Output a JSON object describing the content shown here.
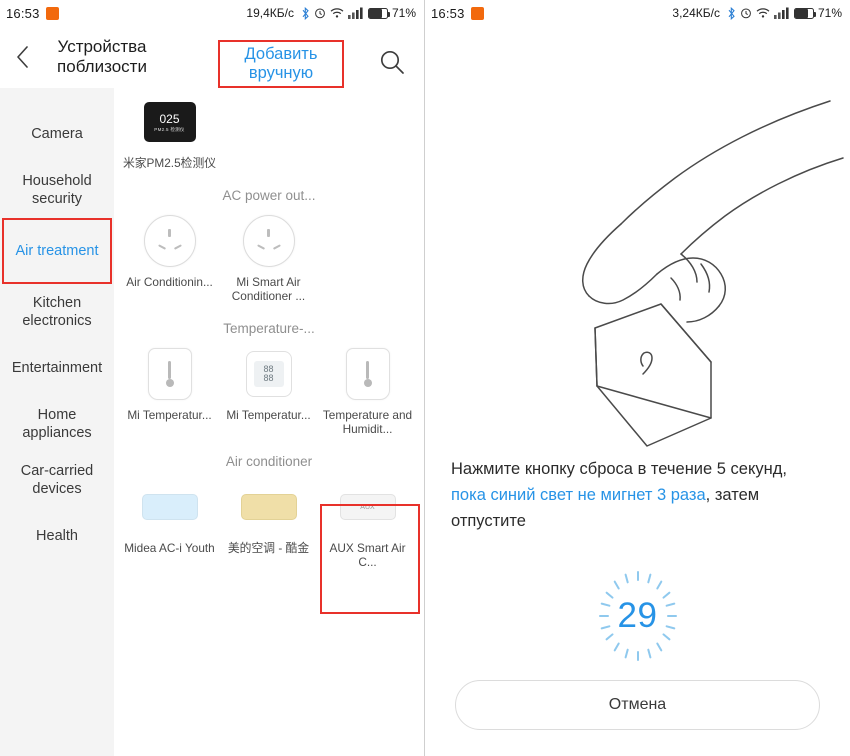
{
  "left": {
    "statusbar": {
      "time": "16:53",
      "rate": "19,4КБ/c",
      "battery_pct": "71%",
      "battery_level": 71,
      "icons": [
        "alarm-icon",
        "bluetooth-icon",
        "wifi-icon",
        "signal-icon",
        "battery-icon"
      ]
    },
    "header": {
      "back": "back-arrow-icon",
      "title": "Устройства поблизости",
      "manual_add": "Добавить вручную",
      "search": "search-icon"
    },
    "categories": [
      {
        "label": "Camera",
        "active": false,
        "boxed": false
      },
      {
        "label": "Household security",
        "active": false,
        "boxed": false
      },
      {
        "label": "Air treatment",
        "active": true,
        "boxed": true
      },
      {
        "label": "Kitchen electronics",
        "active": false,
        "boxed": false
      },
      {
        "label": "Entertainment",
        "active": false,
        "boxed": false
      },
      {
        "label": "Home appliances",
        "active": false,
        "boxed": false
      },
      {
        "label": "Car-carried devices",
        "active": false,
        "boxed": false
      },
      {
        "label": "Health",
        "active": false,
        "boxed": false
      }
    ],
    "sections": [
      {
        "title": "",
        "items": [
          {
            "label": "米家PM2.5检测仪",
            "icon": "pm25-detector-icon",
            "value": "025",
            "sub": "PM2.5 检测仪",
            "boxed": false
          }
        ]
      },
      {
        "title": "AC power out...",
        "items": [
          {
            "label": "Air Conditionin...",
            "icon": "power-socket-icon",
            "boxed": false
          },
          {
            "label": "Mi Smart Air Conditioner ...",
            "icon": "power-socket-icon",
            "boxed": false
          }
        ]
      },
      {
        "title": "Temperature-...",
        "items": [
          {
            "label": "Mi Temperatur...",
            "icon": "thermometer-sensor-icon",
            "boxed": false
          },
          {
            "label": "Mi Temperatur...",
            "icon": "lcd-thermometer-icon",
            "boxed": false
          },
          {
            "label": "Temperature and Humidit...",
            "icon": "thermometer-sensor-icon",
            "boxed": true
          }
        ]
      },
      {
        "title": "Air conditioner",
        "items": [
          {
            "label": "Midea AC-i Youth",
            "icon": "air-conditioner-icon",
            "boxed": false
          },
          {
            "label": "美的空调 - 酷金",
            "icon": "air-conditioner-icon",
            "boxed": false
          },
          {
            "label": "AUX Smart Air C...",
            "icon": "air-conditioner-icon",
            "brand": "AUX",
            "boxed": false
          }
        ]
      }
    ]
  },
  "right": {
    "statusbar": {
      "time": "16:53",
      "rate": "3,24КБ/c",
      "battery_pct": "71%",
      "battery_level": 71,
      "icons": [
        "alarm-icon",
        "bluetooth-icon",
        "wifi-icon",
        "signal-icon",
        "battery-icon"
      ]
    },
    "illustration": "hand-pressing-reset-button-illustration",
    "instruction": {
      "part1": "Нажмите кнопку сброса в течение 5 секунд, ",
      "accent": "пока синий свет не мигнет 3 раза",
      "part2": ", затем отпустите"
    },
    "counter": "29",
    "cancel_label": "Отмена",
    "accent_color": "#2793e6",
    "highlight_color": "#e8312a"
  }
}
